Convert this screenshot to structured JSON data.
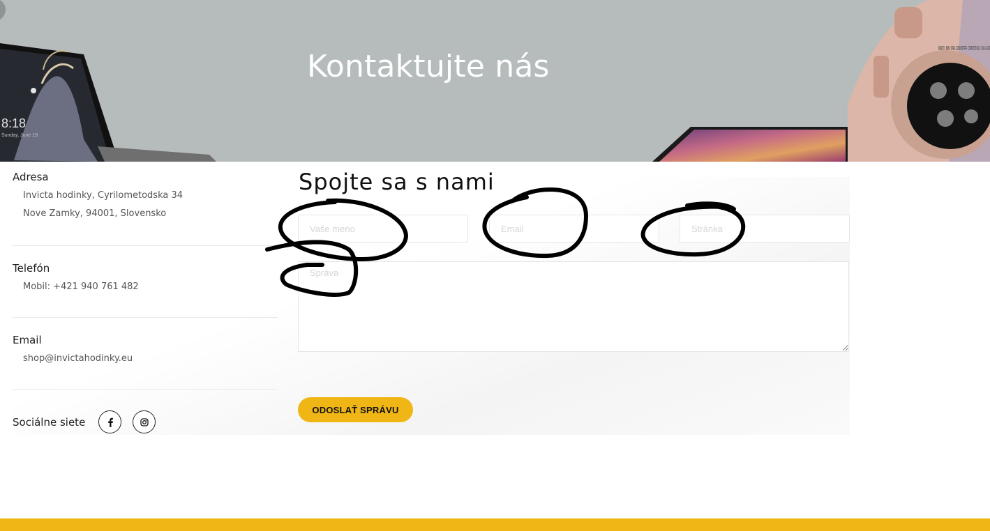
{
  "hero": {
    "title": "Kontaktujte nás",
    "laptop_clock": "8:18",
    "laptop_date": "Sunday, June 19",
    "watch_engraving": "⌘WATCH · 38MM · SERIAL C02WKHOP7FFB · COMPOSITE BACK · ION-X GLASS"
  },
  "contact": {
    "address_label": "Adresa",
    "address_line1": "Invicta hodinky, Cyrilometodska 34",
    "address_line2": "Nove Zamky, 94001, Slovensko",
    "phone_label": "Telefón",
    "phone_value": "Mobil: +421 940 761 482",
    "email_label": "Email",
    "email_value": "shop@invictahodinky.eu",
    "social_label": "Sociálne siete",
    "social_icons": [
      "facebook-icon",
      "instagram-icon"
    ]
  },
  "form": {
    "title": "Spojte sa s nami",
    "name_placeholder": "Vaše meno",
    "email_placeholder": "Email",
    "site_placeholder": "Stránka",
    "message_placeholder": "Správa",
    "submit_label": "ODOSLAŤ SPRÁVU"
  },
  "colors": {
    "hero_bg": "#b6bcbb",
    "accent": "#efb615",
    "scribble": "#000000"
  }
}
